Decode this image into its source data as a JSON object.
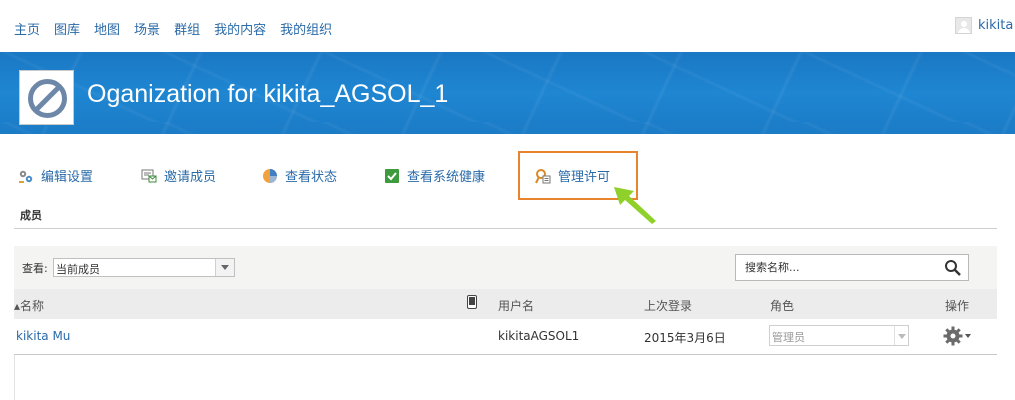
{
  "nav": {
    "items": [
      "主页",
      "图库",
      "地图",
      "场景",
      "群组",
      "我的内容",
      "我的组织"
    ],
    "user": "kikita"
  },
  "banner": {
    "title": "Oganization for kikita_AGSOL_1"
  },
  "actions": {
    "edit_settings": "编辑设置",
    "invite_members": "邀请成员",
    "view_status": "查看状态",
    "view_health": "查看系统健康",
    "manage_licenses": "管理许可"
  },
  "section": {
    "label": "成员"
  },
  "filter": {
    "view_label": "查看:",
    "view_value": "当前成员",
    "search_placeholder": "搜索名称..."
  },
  "table": {
    "headers": {
      "name": "▴名称",
      "username": "用户名",
      "last_login": "上次登录",
      "role": "角色",
      "actions": "操作"
    },
    "rows": [
      {
        "name": "kikita Mu",
        "username": "kikitaAGSOL1",
        "last_login": "2015年3月6日",
        "role": "管理员"
      }
    ]
  },
  "colors": {
    "link": "#2a6aa8",
    "banner": "#1f86d2",
    "highlight": "#e8842d",
    "arrow": "#8fd12a"
  }
}
